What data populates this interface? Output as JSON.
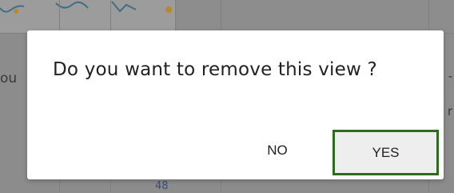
{
  "background": {
    "left_edge_text": "ou",
    "right_edge_text_top": "-",
    "right_edge_text_mid": "r",
    "bottom_number": "48"
  },
  "dialog": {
    "message": "Do you want to remove this view ?",
    "no_label": "NO",
    "yes_label": "YES",
    "focus_color": "#2f6a1f"
  }
}
